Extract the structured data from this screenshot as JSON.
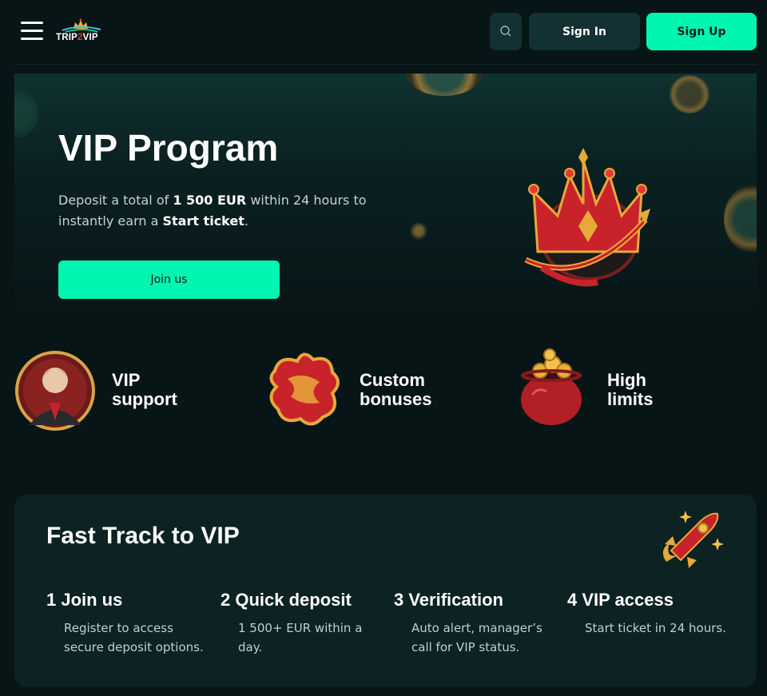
{
  "header": {
    "logo": {
      "part1": "TRIP",
      "part2": "2",
      "part3": "VIP"
    },
    "icons": {
      "menu": "hamburger-menu-icon",
      "search": "search-icon"
    },
    "signin_label": "Sign In",
    "signup_label": "Sign Up"
  },
  "hero": {
    "title": "VIP Program",
    "desc_part1": "Deposit a total of ",
    "desc_amount": "1 500 EUR",
    "desc_part2": " within 24 hours to instantly earn a ",
    "desc_ticket": "Start ticket",
    "desc_part3": ".",
    "cta_label": "Join us",
    "illustration": "crown-icon"
  },
  "features": [
    {
      "line1": "VIP",
      "line2": "support",
      "icon": "vip-manager-icon"
    },
    {
      "line1": "Custom",
      "line2": "bonuses",
      "icon": "puzzle-icon"
    },
    {
      "line1": "High",
      "line2": "limits",
      "icon": "gold-pot-icon"
    }
  ],
  "fast_track": {
    "title": "Fast Track to VIP",
    "illustration": "rocket-icon",
    "steps": [
      {
        "title": "1 Join us",
        "desc": "Register to access secure deposit options."
      },
      {
        "title": "2 Quick deposit",
        "desc": "1 500+ EUR within a day."
      },
      {
        "title": "3 Verification",
        "desc": "Auto alert, manager’s call for VIP status."
      },
      {
        "title": "4 VIP access",
        "desc": "Start ticket in 24 hours."
      }
    ]
  },
  "colors": {
    "background": "#081517",
    "accent": "#00f5b0",
    "button_dark": "#133033",
    "card": "#0c2223"
  }
}
